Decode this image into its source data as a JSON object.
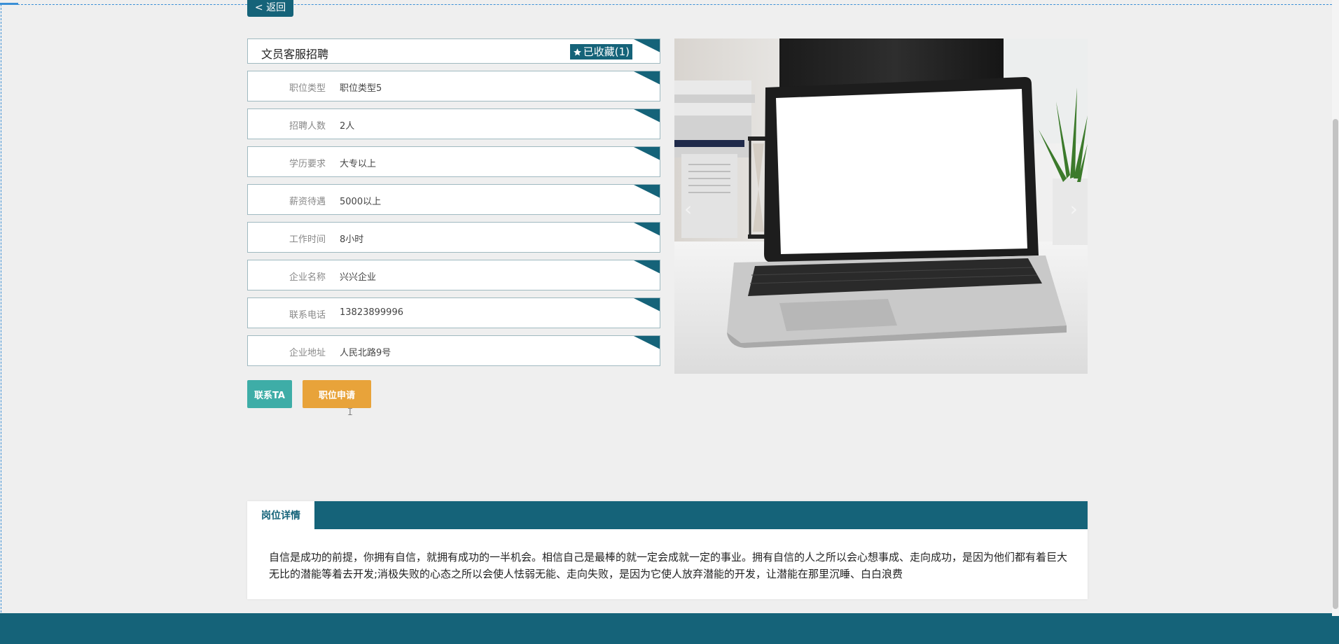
{
  "header": {
    "back_label": "< 返回"
  },
  "job": {
    "title": "文员客服招聘",
    "favorite_label": "已收藏(1)"
  },
  "fields": [
    {
      "label": "职位类型",
      "value": "职位类型5"
    },
    {
      "label": "招聘人数",
      "value": "2人"
    },
    {
      "label": "学历要求",
      "value": "大专以上"
    },
    {
      "label": "薪资待遇",
      "value": "5000以上"
    },
    {
      "label": "工作时间",
      "value": "8小时"
    },
    {
      "label": "企业名称",
      "value": "兴兴企业"
    },
    {
      "label": "联系电话",
      "value": "13823899996"
    },
    {
      "label": "企业地址",
      "value": "人民北路9号"
    }
  ],
  "actions": {
    "contact_label": "联系TA",
    "apply_label": "职位申请"
  },
  "carousel": {
    "prev": "‹",
    "next": "›"
  },
  "detail": {
    "tab_label": "岗位详情",
    "text": "自信是成功的前提，你拥有自信，就拥有成功的一半机会。相信自己是最棒的就一定会成就一定的事业。拥有自信的人之所以会心想事成、走向成功，是因为他们都有着巨大无比的潜能等着去开发;消极失败的心态之所以会使人怯弱无能、走向失败，是因为它使人放弃潜能的开发，让潜能在那里沉睡、白白浪费"
  },
  "colors": {
    "primary": "#156379",
    "contact": "#3eada7",
    "apply": "#e8a33a"
  }
}
